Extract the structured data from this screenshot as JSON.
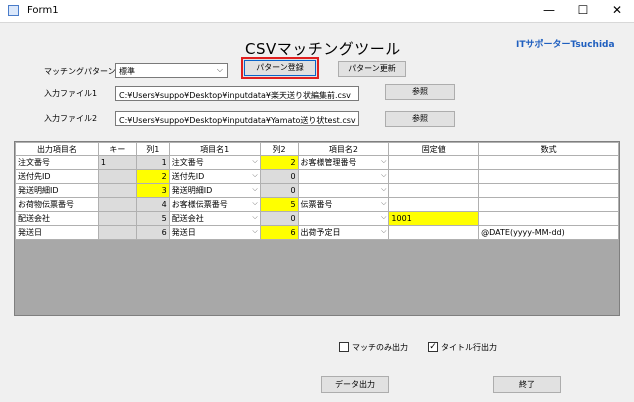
{
  "window": {
    "title": "Form1",
    "minimize": "—",
    "maximize": "☐",
    "close": "✕"
  },
  "header": {
    "title": "CSVマッチングツール",
    "brand": "ITサポーターTsuchida"
  },
  "pattern": {
    "label": "マッチングパターン",
    "value": "標準",
    "register_button": "パターン登録",
    "update_button": "パターン更新"
  },
  "input1": {
    "label": "入力ファイル1",
    "value": "C:¥Users¥suppo¥Desktop¥inputdata¥楽天送り状編集前.csv",
    "browse": "参照"
  },
  "input2": {
    "label": "入力ファイル2",
    "value": "C:¥Users¥suppo¥Desktop¥inputdata¥Yamato送り状test.csv",
    "browse": "参照"
  },
  "grid": {
    "headers": [
      "出力項目名",
      "キー",
      "列1",
      "項目名1",
      "列2",
      "項目名2",
      "固定値",
      "数式"
    ],
    "rows": [
      {
        "name": "注文番号",
        "key": "1",
        "col1": "1",
        "item1": "注文番号",
        "col2": "2",
        "item2": "お客様管理番号",
        "fixed": "",
        "formula": "",
        "y1": false,
        "y2": true,
        "yf": false
      },
      {
        "name": "送付先ID",
        "key": "",
        "col1": "2",
        "item1": "送付先ID",
        "col2": "0",
        "item2": "",
        "fixed": "",
        "formula": "",
        "y1": true,
        "y2": false,
        "yf": false
      },
      {
        "name": "発送明細ID",
        "key": "",
        "col1": "3",
        "item1": "発送明細ID",
        "col2": "0",
        "item2": "",
        "fixed": "",
        "formula": "",
        "y1": true,
        "y2": false,
        "yf": false
      },
      {
        "name": "お荷物伝票番号",
        "key": "",
        "col1": "4",
        "item1": "お客様伝票番号",
        "col2": "5",
        "item2": "伝票番号",
        "fixed": "",
        "formula": "",
        "y1": false,
        "y2": true,
        "yf": false
      },
      {
        "name": "配送会社",
        "key": "",
        "col1": "5",
        "item1": "配送会社",
        "col2": "0",
        "item2": "",
        "fixed": "1001",
        "formula": "",
        "y1": false,
        "y2": false,
        "yf": true
      },
      {
        "name": "発送日",
        "key": "",
        "col1": "6",
        "item1": "発送日",
        "col2": "6",
        "item2": "出荷予定日",
        "fixed": "",
        "formula": "@DATE(yyyy-MM-dd)",
        "y1": false,
        "y2": true,
        "yf": false
      }
    ]
  },
  "options": {
    "match_only": "マッチのみ出力",
    "match_only_checked": false,
    "title_row": "タイトル行出力",
    "title_row_checked": true
  },
  "footer": {
    "export_button": "データ出力",
    "exit_button": "終了"
  },
  "colors": {
    "highlight": "#ffff00",
    "focus_border": "#e0201f",
    "brand": "#1f5fbf"
  }
}
